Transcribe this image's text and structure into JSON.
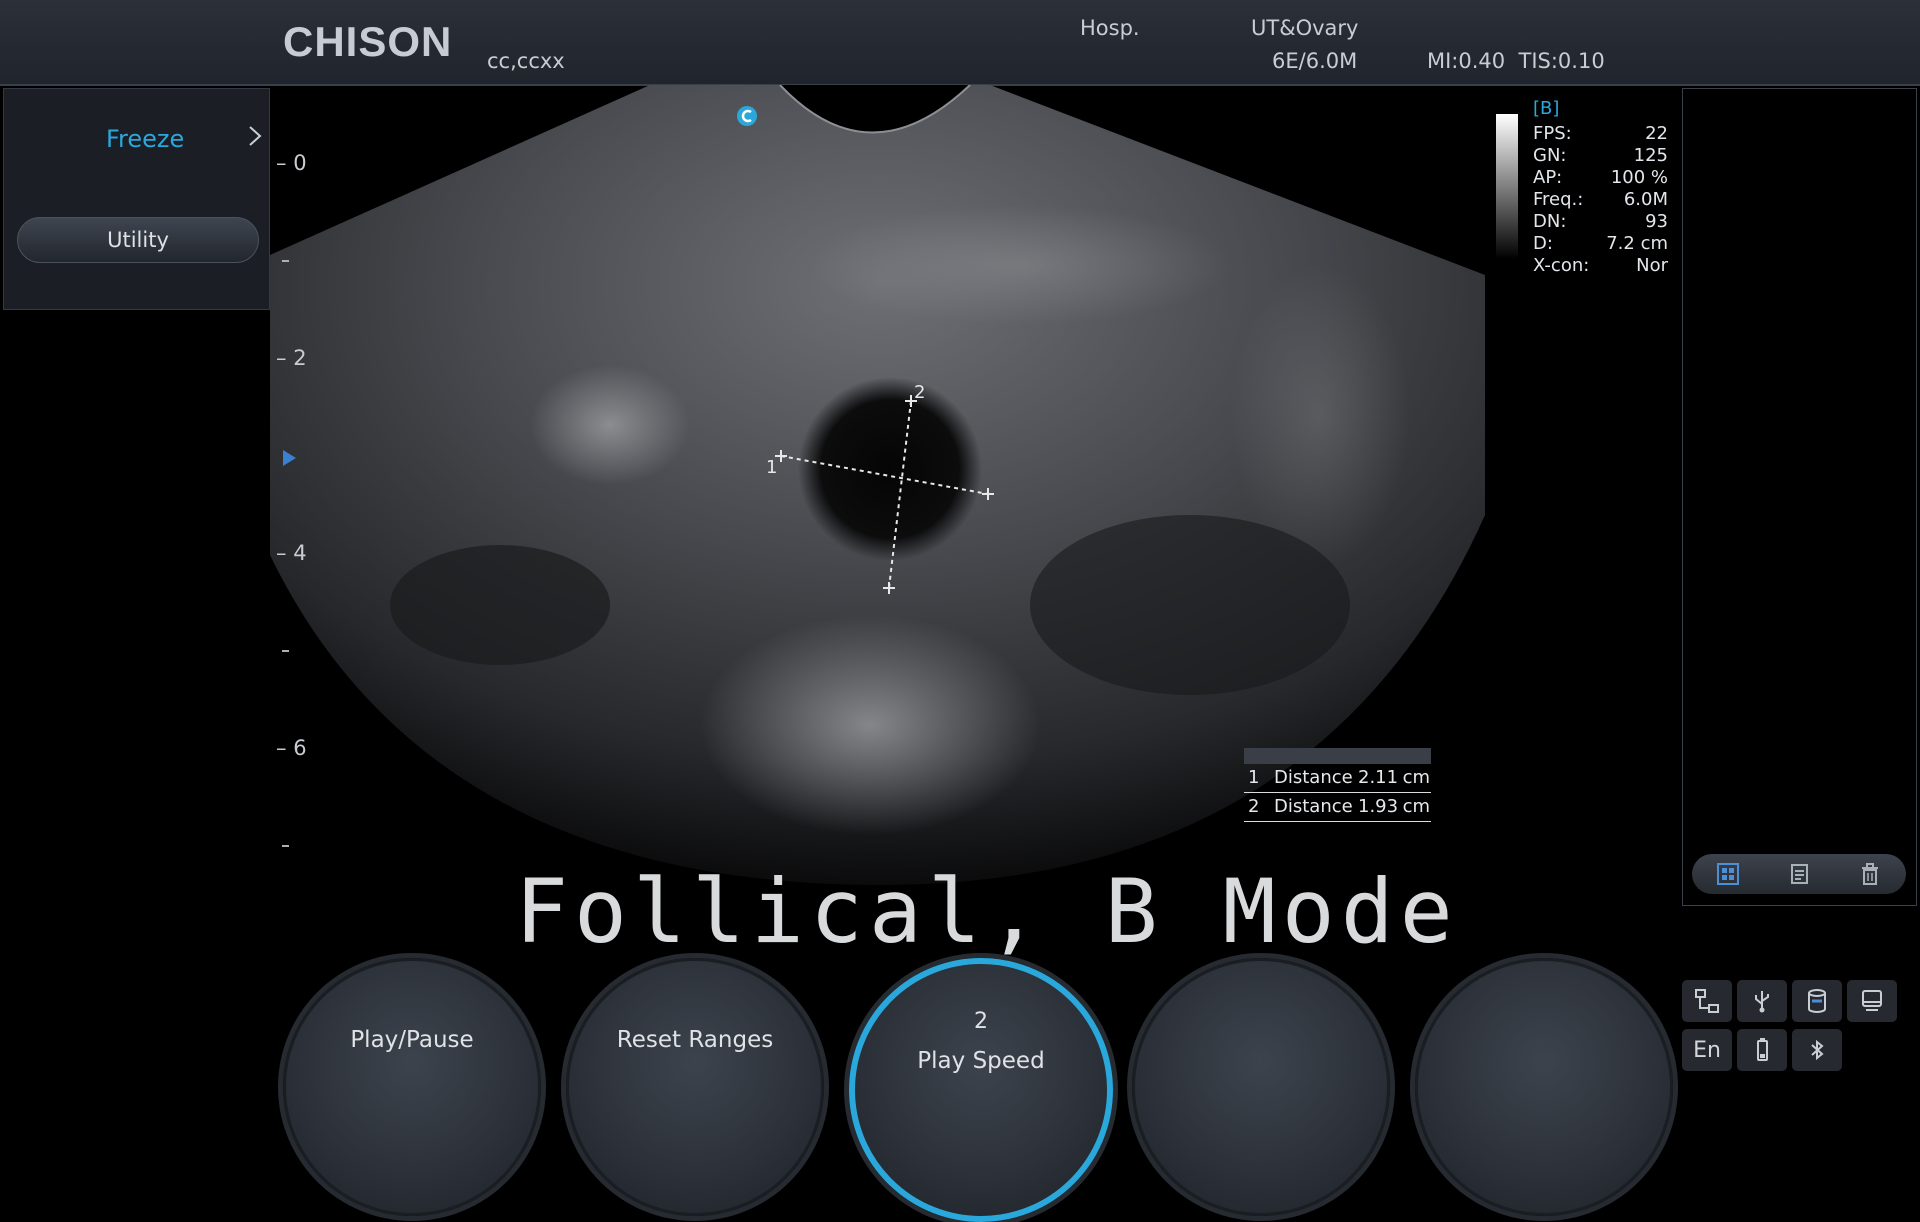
{
  "header": {
    "brand": "CHISON",
    "patient": "cc,ccxx",
    "hospital": "Hosp.",
    "preset": "UT&Ovary",
    "probe": "6E/6.0M",
    "indices": "MI:0.40  TIS:0.10"
  },
  "left_menu": {
    "freeze_label": "Freeze",
    "utility_label": "Utility"
  },
  "depth_scale": {
    "labels": [
      "0",
      "2",
      "4",
      "6"
    ]
  },
  "params": {
    "mode": "[B]",
    "rows": [
      {
        "key": "FPS:",
        "value": "22"
      },
      {
        "key": "GN:",
        "value": "125"
      },
      {
        "key": "AP:",
        "value": "100 %"
      },
      {
        "key": "Freq.:",
        "value": "6.0M"
      },
      {
        "key": "DN:",
        "value": "93"
      },
      {
        "key": "D:",
        "value": "7.2 cm"
      },
      {
        "key": "X-con:",
        "value": "Nor"
      }
    ]
  },
  "markers": {
    "m1": "1",
    "m2": "2"
  },
  "measurements": [
    {
      "index": "1",
      "name": "Distance",
      "value": "2.11",
      "unit": "cm"
    },
    {
      "index": "2",
      "name": "Distance",
      "value": "1.93",
      "unit": "cm"
    }
  ],
  "caption": "Follical, B Mode",
  "knobs": {
    "play_pause": "Play/Pause",
    "reset_ranges": "Reset Ranges",
    "play_speed_value": "2",
    "play_speed": "Play Speed"
  },
  "status": {
    "language": "En"
  },
  "colors": {
    "accent": "#2aa8dc",
    "panel": "#1b1e24",
    "topbar": "#2b3039"
  }
}
